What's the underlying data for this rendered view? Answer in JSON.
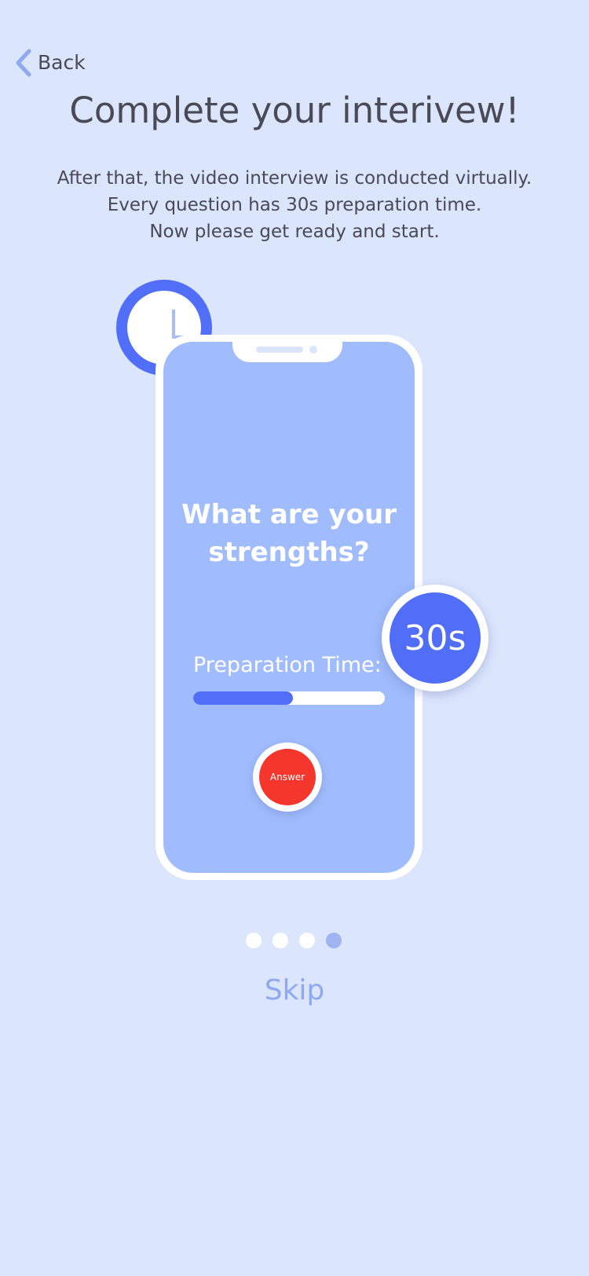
{
  "nav": {
    "back_label": "Back",
    "back_icon": "chevron-left-icon"
  },
  "title": "Complete your interivew!",
  "description": [
    "After that, the video interview is conducted virtually.",
    "Every question has 30s preparation time.",
    "Now please get ready and start."
  ],
  "phone": {
    "question_line1": "What are your",
    "question_line2": "strengths?",
    "prep_label": "Preparation Time:",
    "prep_progress": 0.52,
    "answer_label": "Answer"
  },
  "timer": {
    "label": "30s"
  },
  "clock_icon": "clock-icon",
  "pagination": {
    "count": 4,
    "active_index": 3
  },
  "skip_label": "Skip",
  "colors": {
    "background": "#dbe6fd",
    "accent": "#506ef8",
    "screen": "#a0bcfc",
    "answer": "#f5362d",
    "skip": "#8fa8f0"
  }
}
